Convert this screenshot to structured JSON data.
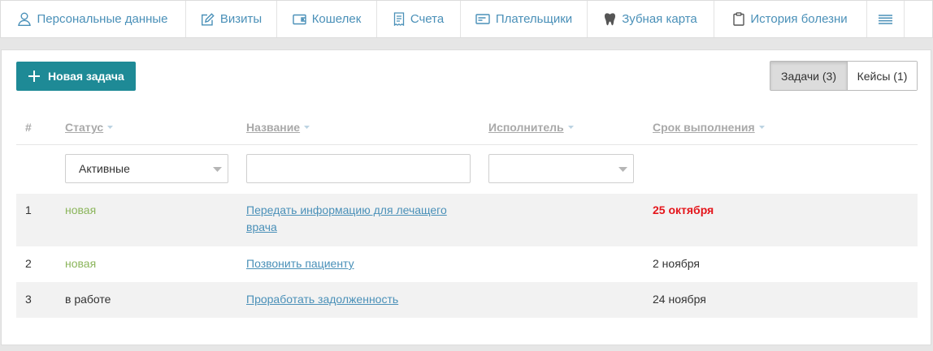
{
  "tabs": [
    {
      "label": "Персональные данные",
      "icon": "person-icon"
    },
    {
      "label": "Визиты",
      "icon": "edit-icon"
    },
    {
      "label": "Кошелек",
      "icon": "wallet-icon"
    },
    {
      "label": "Счета",
      "icon": "receipt-icon"
    },
    {
      "label": "Плательщики",
      "icon": "card-icon"
    },
    {
      "label": "Зубная карта",
      "icon": "tooth-icon"
    },
    {
      "label": "История болезни",
      "icon": "clipboard-icon"
    },
    {
      "label": "",
      "icon": "menu-icon"
    }
  ],
  "toolbar": {
    "new_task_label": "Новая задача",
    "segments": [
      "Задачи (3)",
      "Кейсы (1)"
    ],
    "active_segment": "Задачи (3)"
  },
  "table": {
    "columns": [
      "#",
      "Статус",
      "Название",
      "Исполнитель",
      "Срок выполнения"
    ],
    "filters": {
      "status_value": "Активные",
      "name_value": "",
      "assignee_value": ""
    },
    "rows": [
      {
        "num": "1",
        "status": "новая",
        "status_kind": "new",
        "title": "Передать информацию для лечащего врача",
        "title_line1": "Передать информацию для лечащего",
        "title_line2": "врача",
        "assignee": "",
        "due": "25 октября",
        "overdue": true
      },
      {
        "num": "2",
        "status": "новая",
        "status_kind": "new",
        "title": "Позвонить пациенту",
        "assignee": "",
        "due": "2 ноября",
        "overdue": false
      },
      {
        "num": "3",
        "status": "в работе",
        "status_kind": "work",
        "title": "Проработать задолженность",
        "assignee": "",
        "due": "24 ноября",
        "overdue": false
      }
    ]
  },
  "colors": {
    "link": "#4a90b8",
    "primary_button": "#1e8a96",
    "status_new": "#8bb55b",
    "overdue": "#e4151b"
  }
}
